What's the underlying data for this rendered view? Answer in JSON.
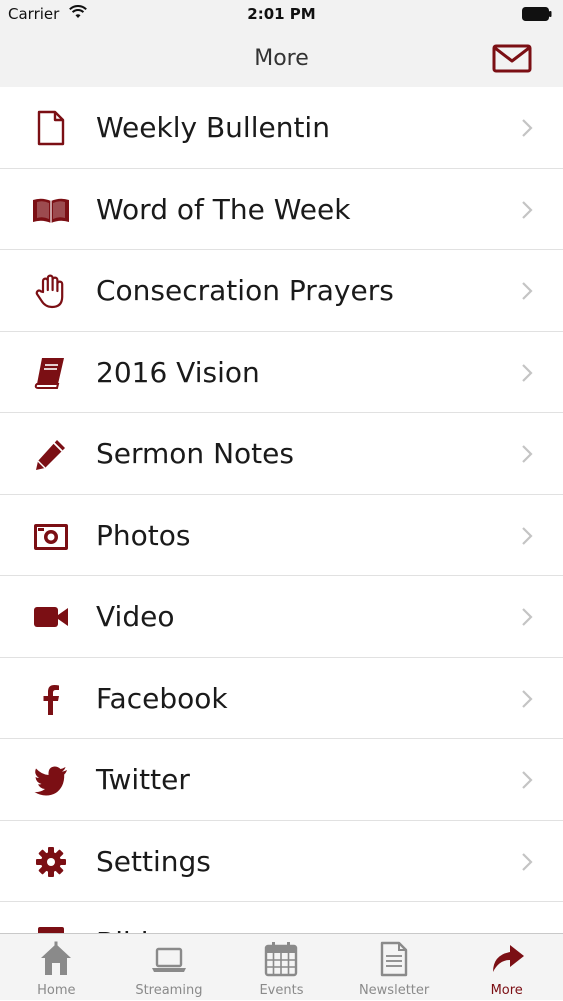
{
  "status_bar": {
    "carrier": "Carrier",
    "time": "2:01 PM"
  },
  "nav": {
    "title": "More",
    "mail_icon": "envelope-icon"
  },
  "colors": {
    "accent": "#7b0f14",
    "tab_inactive": "#8a8a8a",
    "bar_bg": "#f2f2f2"
  },
  "menu": {
    "items": [
      {
        "label": "Weekly Bullentin",
        "icon": "document-icon"
      },
      {
        "label": "Word of The Week",
        "icon": "open-book-icon"
      },
      {
        "label": "Consecration Prayers",
        "icon": "hand-icon"
      },
      {
        "label": "2016 Vision",
        "icon": "book-icon"
      },
      {
        "label": "Sermon Notes",
        "icon": "pencil-icon"
      },
      {
        "label": "Photos",
        "icon": "camera-icon"
      },
      {
        "label": "Video",
        "icon": "video-camera-icon"
      },
      {
        "label": "Facebook",
        "icon": "facebook-icon"
      },
      {
        "label": "Twitter",
        "icon": "twitter-icon"
      },
      {
        "label": "Settings",
        "icon": "gear-icon"
      },
      {
        "label": "Bible",
        "icon": "bible-icon"
      }
    ]
  },
  "tabs": [
    {
      "label": "Home",
      "icon": "home-icon",
      "active": false
    },
    {
      "label": "Streaming",
      "icon": "laptop-icon",
      "active": false
    },
    {
      "label": "Events",
      "icon": "calendar-icon",
      "active": false
    },
    {
      "label": "Newsletter",
      "icon": "newsletter-icon",
      "active": false
    },
    {
      "label": "More",
      "icon": "share-arrow-icon",
      "active": true
    }
  ]
}
